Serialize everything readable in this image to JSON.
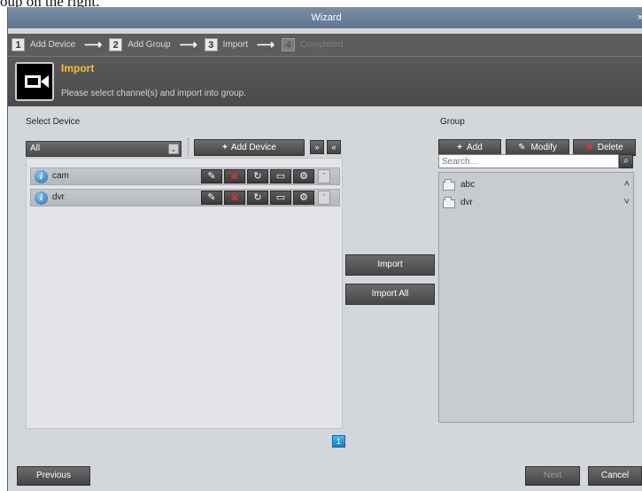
{
  "caption": "oup on the right.",
  "window": {
    "title": "Wizard",
    "close_glyph": "×"
  },
  "steps": [
    {
      "num": "1",
      "label": "Add Device"
    },
    {
      "num": "2",
      "label": "Add Group"
    },
    {
      "num": "3",
      "label": "Import"
    },
    {
      "num": "4",
      "label": "Completed"
    }
  ],
  "header": {
    "title": "Import",
    "description": "Please select channel(s) and import into group.",
    "icon": "camera-icon"
  },
  "select_device": {
    "label": "Select Device",
    "filter_value": "All",
    "add_device_label": "Add Device",
    "expand_glyph": "»",
    "collapse_glyph": "«",
    "devices": [
      {
        "name": "cam"
      },
      {
        "name": "dvr"
      }
    ]
  },
  "pagination": {
    "current": "1"
  },
  "actions": {
    "import": "Import",
    "import_all": "Import All"
  },
  "group": {
    "label": "Group",
    "add": "Add",
    "modify": "Modify",
    "delete": "Delete",
    "search_placeholder": "Search...",
    "items": [
      {
        "name": "abc",
        "chevron": "˄"
      },
      {
        "name": "dvr",
        "chevron": "˅"
      }
    ]
  },
  "footer": {
    "previous": "Previous",
    "next": "Next",
    "cancel": "Cancel"
  },
  "colors": {
    "accent_title": "#f2c230",
    "page_active": "#1480c6",
    "delete_mark": "#dd3333"
  }
}
